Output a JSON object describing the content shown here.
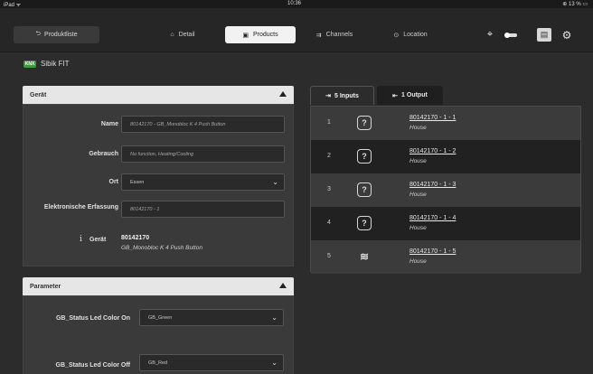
{
  "status_bar": {
    "device": "iPad ᯤ",
    "time": "10:36",
    "battery": "⊕ 13 % ▭"
  },
  "nav": {
    "back_label": "Produktliste",
    "tabs": [
      {
        "label": "Detail",
        "icon": "home-icon"
      },
      {
        "label": "Products",
        "icon": "box-icon",
        "active": true
      },
      {
        "label": "Channels",
        "icon": "channels-icon"
      },
      {
        "label": "Location",
        "icon": "location-pin-icon"
      }
    ],
    "right_icons": [
      "crosshair-icon",
      "toggle-icon",
      "document-icon",
      "gears-icon"
    ]
  },
  "device_title": "Sibik FIT",
  "logo_text": "KNX",
  "geraet_panel": {
    "header": "Gerät",
    "fields": {
      "name_label": "Name",
      "name_value": "80142170 - GB_Monobloc K 4 Push Button",
      "gebrauch_label": "Gebrauch",
      "gebrauch_placeholder": "No function, Heating/Cooling",
      "ort_label": "Ort",
      "ort_value": "Essen",
      "erfassung_label": "Elektronische Erfassung",
      "erfassung_value": "80142170 - 1"
    },
    "info": {
      "icon_glyph": "i",
      "label": "Gerät",
      "code": "80142170",
      "name": "GB_Monobloc K 4 Push Button"
    }
  },
  "parameter_panel": {
    "header": "Parameter",
    "rows": [
      {
        "label": "GB_Status Led Color On",
        "value": "GB_Green"
      },
      {
        "label": "GB_Status Led Color Off",
        "value": "GB_Red"
      }
    ]
  },
  "channel_tabs": {
    "inputs_label": "5 Inputs",
    "outputs_label": "1 Output"
  },
  "channels": [
    {
      "number": "1",
      "icon": "question-icon",
      "icon_glyph": "?",
      "name": "80142170 - 1 - 1",
      "location": "House"
    },
    {
      "number": "2",
      "icon": "question-icon",
      "icon_glyph": "?",
      "name": "80142170 - 1 - 2",
      "location": "House"
    },
    {
      "number": "3",
      "icon": "question-icon",
      "icon_glyph": "?",
      "name": "80142170 - 1 - 3",
      "location": "House"
    },
    {
      "number": "4",
      "icon": "question-icon",
      "icon_glyph": "?",
      "name": "80142170 - 1 - 4",
      "location": "House"
    },
    {
      "number": "5",
      "icon": "heating-wave-icon",
      "icon_glyph": "≋",
      "name": "80142170 - 1 - 5",
      "location": "House"
    }
  ]
}
